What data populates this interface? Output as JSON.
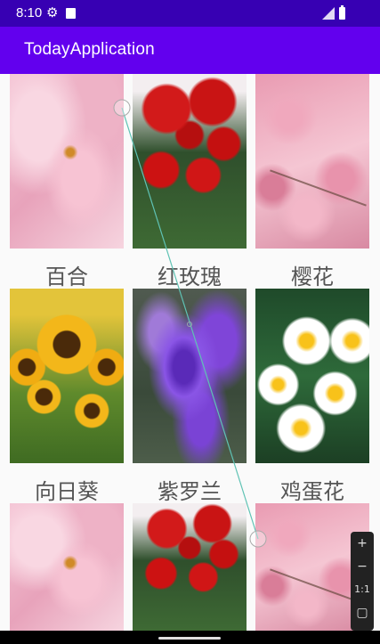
{
  "status_bar": {
    "time": "8:10",
    "icons": [
      "gear-icon",
      "sd-card-icon",
      "signal-icon",
      "battery-icon"
    ]
  },
  "app_bar": {
    "title": "TodayApplication",
    "color": "#6200ee",
    "status_color": "#3700b3"
  },
  "grid": [
    {
      "label": "百合",
      "image": "lily-photo"
    },
    {
      "label": "红玫瑰",
      "image": "red-rose-photo"
    },
    {
      "label": "樱花",
      "image": "cherry-blossom-photo"
    },
    {
      "label": "向日葵",
      "image": "sunflower-photo"
    },
    {
      "label": "紫罗兰",
      "image": "violet-photo"
    },
    {
      "label": "鸡蛋花",
      "image": "frangipani-photo"
    },
    {
      "label": "",
      "image": "lily-photo"
    },
    {
      "label": "",
      "image": "red-rose-photo"
    },
    {
      "label": "",
      "image": "cherry-blossom-photo"
    }
  ],
  "zoom_controls": {
    "zoom_in": "+",
    "zoom_out": "−",
    "one_to_one": "1:1",
    "fit_icon": "fit-screen-icon"
  }
}
